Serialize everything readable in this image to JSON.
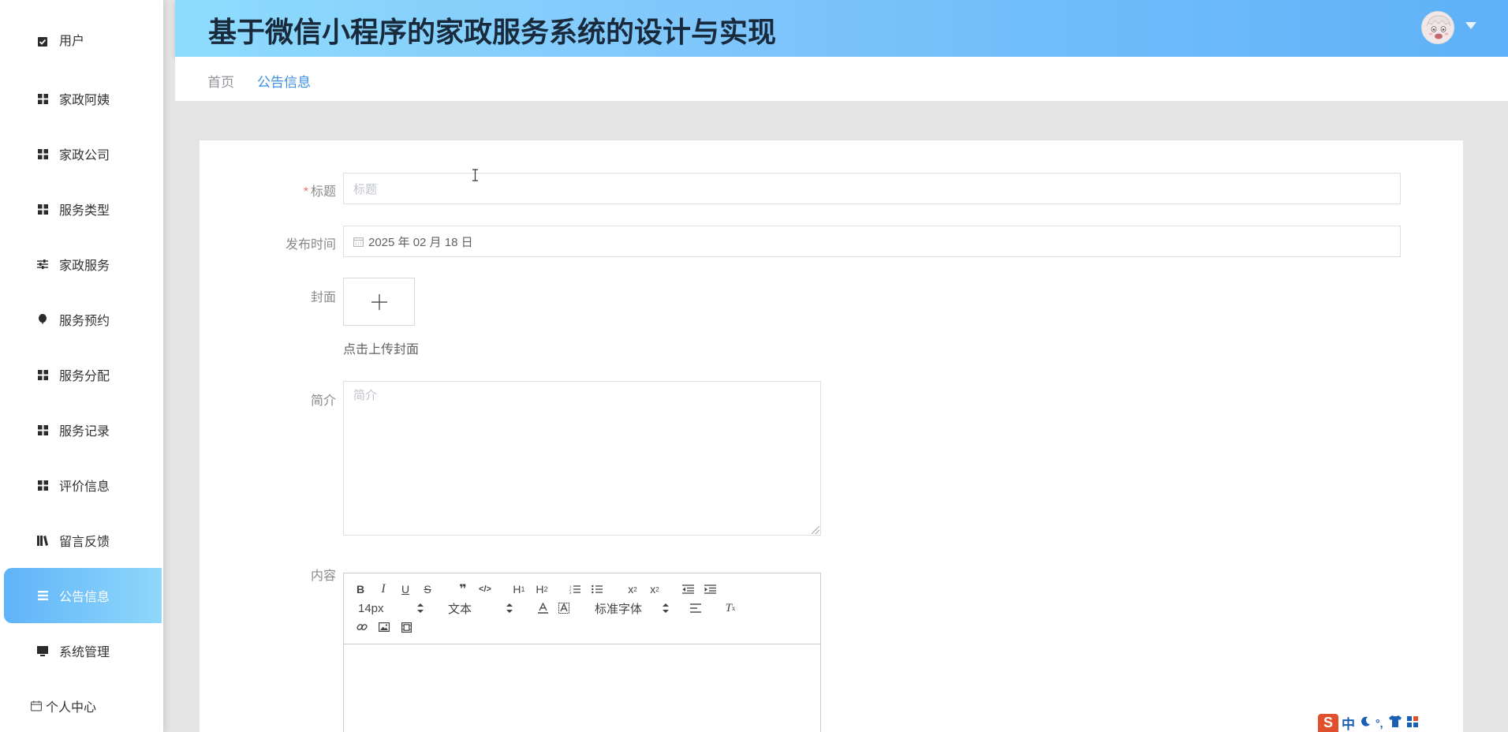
{
  "header": {
    "title": "基于微信小程序的家政服务系统的设计与实现"
  },
  "breadcrumb": {
    "home": "首页",
    "current": "公告信息"
  },
  "sidebar": {
    "items": [
      {
        "label": "用户",
        "icon": "check-square-icon"
      },
      {
        "label": "家政阿姨",
        "icon": "grid-icon"
      },
      {
        "label": "家政公司",
        "icon": "grid-icon"
      },
      {
        "label": "服务类型",
        "icon": "grid-icon"
      },
      {
        "label": "家政服务",
        "icon": "sliders-icon"
      },
      {
        "label": "服务预约",
        "icon": "balloon-icon"
      },
      {
        "label": "服务分配",
        "icon": "grid-icon"
      },
      {
        "label": "服务记录",
        "icon": "grid-icon"
      },
      {
        "label": "评价信息",
        "icon": "grid-icon"
      },
      {
        "label": "留言反馈",
        "icon": "book-icon"
      },
      {
        "label": "公告信息",
        "icon": "list-icon",
        "active": true
      },
      {
        "label": "系统管理",
        "icon": "monitor-icon"
      },
      {
        "label": "个人中心",
        "icon": "calendar-icon"
      }
    ]
  },
  "form": {
    "title_label": "标题",
    "title_placeholder": "标题",
    "date_label": "发布时间",
    "date_value": "2025 年 02 月 18 日",
    "cover_label": "封面",
    "cover_hint": "点击上传封面",
    "summary_label": "简介",
    "summary_placeholder": "简介",
    "content_label": "内容"
  },
  "editor": {
    "font_size": "14px",
    "header_select": "文本",
    "font_family": "标准字体",
    "buttons": [
      "B",
      "I",
      "U",
      "S",
      "❞",
      "</>",
      "H1",
      "H2",
      "ol",
      "ul",
      "x₂",
      "x²",
      "outdent",
      "indent",
      "A",
      "A-bg",
      "align",
      "Tx",
      "link",
      "image",
      "video"
    ]
  },
  "ime": {
    "logo": "S",
    "mode": "中"
  },
  "colors": {
    "accent": "#5fb3f9",
    "header_start": "#8edcfd",
    "header_end": "#5eb1f8",
    "required": "#f56c6c"
  }
}
